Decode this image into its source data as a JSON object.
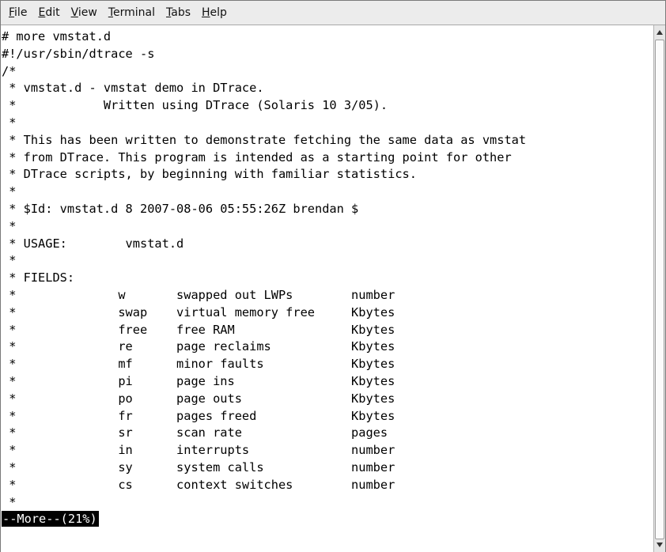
{
  "menu": {
    "items": [
      {
        "first": "F",
        "rest": "ile"
      },
      {
        "first": "E",
        "rest": "dit"
      },
      {
        "first": "V",
        "rest": "iew"
      },
      {
        "first": "T",
        "rest": "erminal"
      },
      {
        "first": "T",
        "rest": "abs"
      },
      {
        "first": "H",
        "rest": "elp"
      }
    ]
  },
  "terminal": {
    "lines": [
      "# more vmstat.d",
      "#!/usr/sbin/dtrace -s",
      "/*",
      " * vmstat.d - vmstat demo in DTrace.",
      " *            Written using DTrace (Solaris 10 3/05).",
      " *",
      " * This has been written to demonstrate fetching the same data as vmstat",
      " * from DTrace. This program is intended as a starting point for other",
      " * DTrace scripts, by beginning with familiar statistics.",
      " *",
      " * $Id: vmstat.d 8 2007-08-06 05:55:26Z brendan $",
      " *",
      " * USAGE:        vmstat.d",
      " *",
      " * FIELDS:",
      " *              w       swapped out LWPs        number",
      " *              swap    virtual memory free     Kbytes",
      " *              free    free RAM                Kbytes",
      " *              re      page reclaims           Kbytes",
      " *              mf      minor faults            Kbytes",
      " *              pi      page ins                Kbytes",
      " *              po      page outs               Kbytes",
      " *              fr      pages freed             Kbytes",
      " *              sr      scan rate               pages",
      " *              in      interrupts              number",
      " *              sy      system calls            number",
      " *              cs      context switches        number",
      " *"
    ],
    "more_prompt": "--More--(21%)"
  }
}
